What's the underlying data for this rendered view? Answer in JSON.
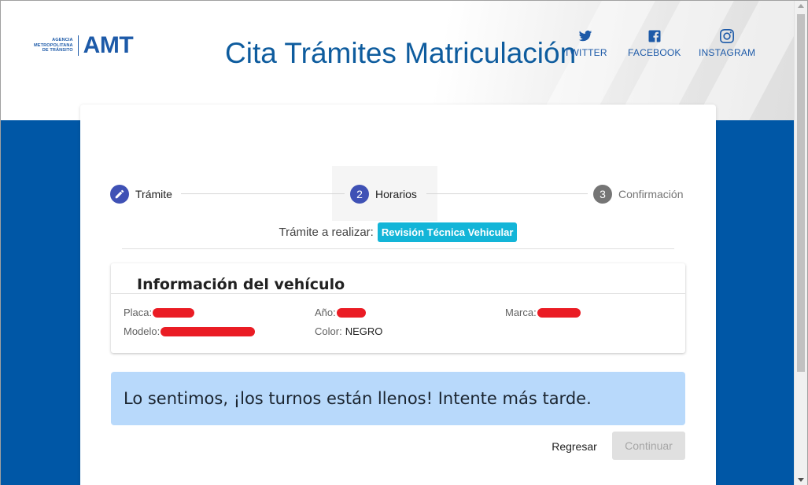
{
  "header": {
    "logo_small_lines": [
      "AGENCIA",
      "METROPOLITANA",
      "DE TRÁNSITO"
    ],
    "logo_big": "AMT",
    "title": "Cita Trámites Matriculación",
    "social": [
      {
        "label": "TWITTER",
        "icon": "twitter-icon"
      },
      {
        "label": "FACEBOOK",
        "icon": "facebook-icon"
      },
      {
        "label": "INSTAGRAM",
        "icon": "instagram-icon"
      }
    ]
  },
  "stepper": {
    "steps": [
      {
        "number": "",
        "icon": "pencil-icon",
        "label": "Trámite",
        "state": "completed"
      },
      {
        "number": "2",
        "label": "Horarios",
        "state": "active"
      },
      {
        "number": "3",
        "label": "Confirmación",
        "state": "pending"
      }
    ]
  },
  "tramite": {
    "label": "Trámite a realizar:",
    "value": "Revisión Técnica Vehicular"
  },
  "vehicle": {
    "title": "Información del vehículo",
    "fields": {
      "placa_label": "Placa:",
      "anio_label": "Año:",
      "marca_label": "Marca:",
      "modelo_label": "Modelo:",
      "color_label": "Color:",
      "color_value": "NEGRO"
    }
  },
  "alert": {
    "message": "Lo sentimos, ¡los turnos están llenos! Intente más tarde."
  },
  "actions": {
    "back_label": "Regresar",
    "continue_label": "Continuar"
  },
  "colors": {
    "brand_blue": "#0057a6",
    "stepper_active": "#3f51b5",
    "badge": "#13b5d8",
    "alert_bg": "#b8d9fb",
    "redaction": "#ea1c24"
  }
}
